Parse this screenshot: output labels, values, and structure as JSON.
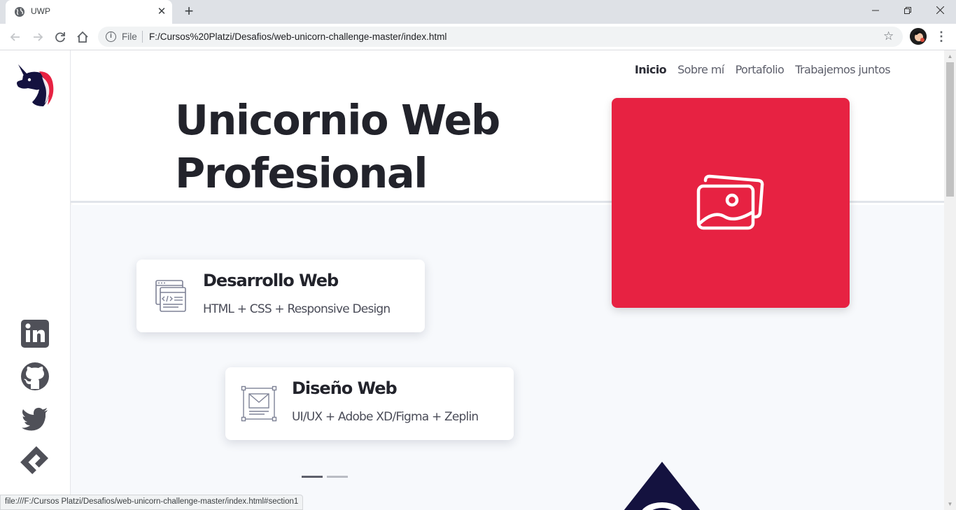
{
  "browser": {
    "tab": {
      "title": "UWP",
      "close_glyph": "✕"
    },
    "new_tab_glyph": "+",
    "window_controls": {
      "minimize": "—",
      "restore": "❐",
      "close": "✕"
    },
    "address": {
      "scheme_label": "File",
      "url": "F:/Cursos%20Platzi/Desafios/web-unicorn-challenge-master/index.html"
    },
    "icons": [
      "back-icon",
      "forward-icon",
      "reload-icon",
      "home-icon",
      "info-icon",
      "star-icon",
      "profile-avatar",
      "menu-icon"
    ]
  },
  "page": {
    "nav": [
      {
        "label": "Inicio",
        "active": true
      },
      {
        "label": "Sobre mí",
        "active": false
      },
      {
        "label": "Portafolio",
        "active": false
      },
      {
        "label": "Trabajemos juntos",
        "active": false
      }
    ],
    "hero": {
      "title_line1": "Unicornio Web",
      "title_line2": "Profesional"
    },
    "cards": [
      {
        "title": "Desarrollo Web",
        "subtitle": "HTML + CSS + Responsive Design",
        "icon": "code-window-icon"
      },
      {
        "title": "Diseño Web",
        "subtitle": "UI/UX + Adobe XD/Figma + Zeplin",
        "icon": "wireframe-icon"
      }
    ],
    "carousel": {
      "count": 2,
      "active_index": 0
    },
    "social": [
      "linkedin-icon",
      "github-icon",
      "twitter-icon",
      "platzi-icon"
    ],
    "colors": {
      "accent": "#e72242",
      "navy": "#14123f",
      "text": "#22232b",
      "hero_bg": "#f7f9fc"
    }
  },
  "status_bar": "file:///F:/Cursos Platzi/Desafios/web-unicorn-challenge-master/index.html#section1"
}
